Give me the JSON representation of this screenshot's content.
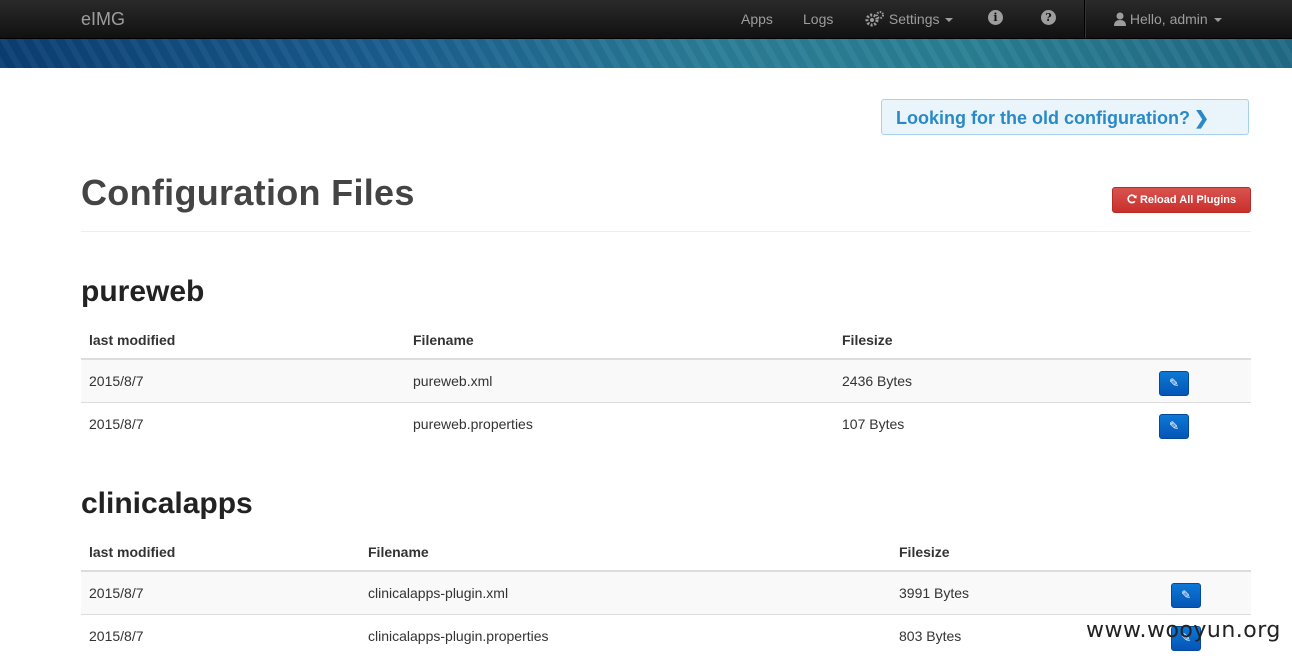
{
  "navbar": {
    "brand": "eIMG",
    "apps": "Apps",
    "logs": "Logs",
    "settings": "Settings",
    "info_icon": "info-icon",
    "help_icon": "help-icon",
    "user": "Hello, admin"
  },
  "alert": {
    "text": "Looking for the old configuration?",
    "chevron": "❯"
  },
  "page": {
    "title": "Configuration Files",
    "reload_label": "Reload All Plugins"
  },
  "sections": [
    {
      "name": "pureweb",
      "headers": [
        "last modified",
        "Filename",
        "Filesize"
      ],
      "rows": [
        {
          "modified": "2015/8/7",
          "filename": "pureweb.xml",
          "filesize": "2436 Bytes"
        },
        {
          "modified": "2015/8/7",
          "filename": "pureweb.properties",
          "filesize": "107 Bytes"
        }
      ]
    },
    {
      "name": "clinicalapps",
      "headers": [
        "last modified",
        "Filename",
        "Filesize"
      ],
      "rows": [
        {
          "modified": "2015/8/7",
          "filename": "clinicalapps-plugin.xml",
          "filesize": "3991 Bytes"
        },
        {
          "modified": "2015/8/7",
          "filename": "clinicalapps-plugin.properties",
          "filesize": "803 Bytes"
        }
      ]
    }
  ],
  "watermark": "www.wooyun.org",
  "colors": {
    "navbar": "#111111",
    "edit_button": "#0866c6",
    "reload_button": "#d2322d",
    "alert_text": "#2a8ac7"
  }
}
